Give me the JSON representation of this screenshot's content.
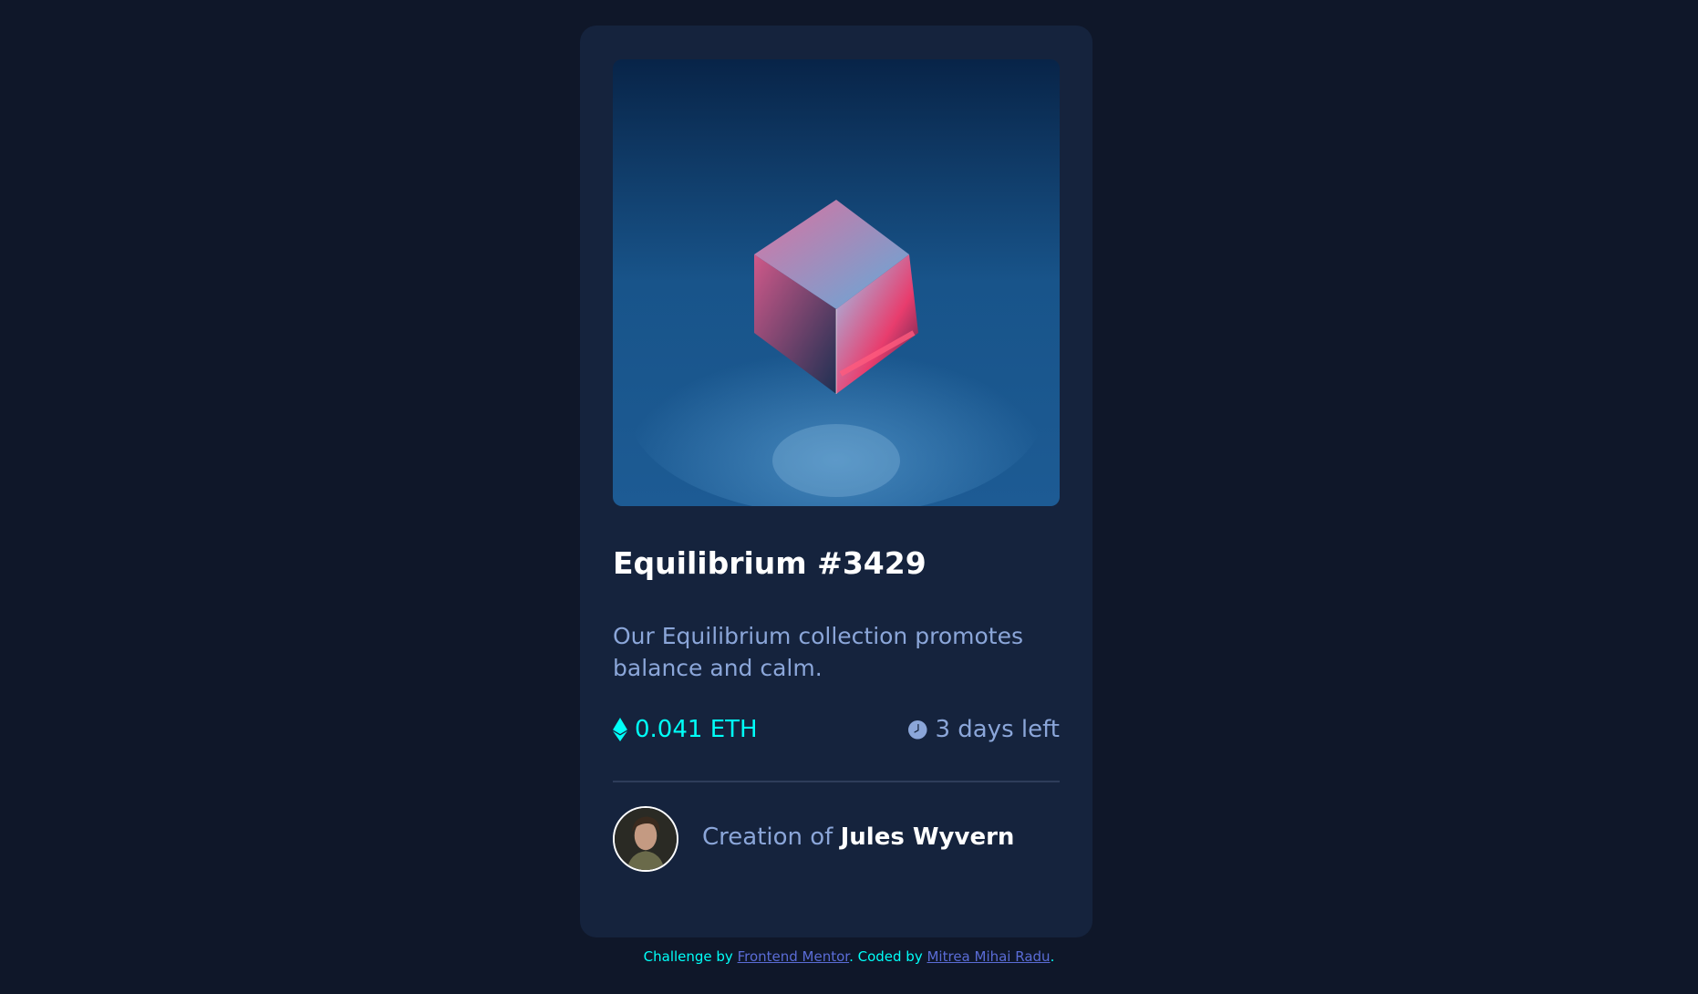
{
  "card": {
    "title": "Equilibrium #3429",
    "description": "Our Equilibrium collection promotes balance and calm.",
    "price": "0.041 ETH",
    "time_left": "3 days left",
    "creator_prefix": "Creation of ",
    "creator_name": "Jules Wyvern"
  },
  "icons": {
    "price_icon": "ethereum-icon",
    "time_icon": "clock-icon"
  },
  "attribution": {
    "prefix": "Challenge by ",
    "link1": "Frontend Mentor",
    "middle": ". Coded by ",
    "link2": "Mitrea Mihai Radu",
    "suffix": "."
  },
  "colors": {
    "background": "#0f1729",
    "card": "#15233d",
    "accent_cyan": "#00fff8",
    "soft_blue": "#8ba6d9",
    "white": "#ffffff",
    "link": "#5a6cd6"
  }
}
